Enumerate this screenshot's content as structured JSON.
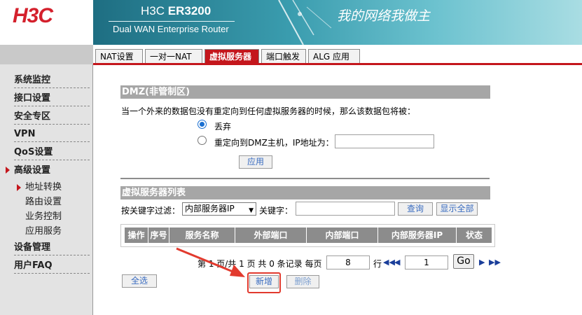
{
  "header": {
    "logo": "H3C",
    "product_prefix": "H3C",
    "product_model": "ER3200",
    "product_subtitle": "Dual WAN Enterprise Router",
    "slogan": "我的网络我做主"
  },
  "sidebar": {
    "items": [
      {
        "label": "系统监控"
      },
      {
        "label": "接口设置"
      },
      {
        "label": "安全专区"
      },
      {
        "label": "VPN"
      },
      {
        "label": "QoS设置"
      },
      {
        "label": "高级设置"
      },
      {
        "label": "设备管理"
      },
      {
        "label": "用户FAQ"
      }
    ],
    "subitems": [
      {
        "label": "地址转换"
      },
      {
        "label": "路由设置"
      },
      {
        "label": "业务控制"
      },
      {
        "label": "应用服务"
      }
    ]
  },
  "tabs": [
    {
      "label": "NAT设置"
    },
    {
      "label": "一对一NAT"
    },
    {
      "label": "虚拟服务器"
    },
    {
      "label": "端口触发"
    },
    {
      "label": "ALG 应用"
    }
  ],
  "dmz": {
    "title": "DMZ(非管制区)",
    "description": "当一个外来的数据包没有重定向到任何虚拟服务器的时候，那么该数据包将被：",
    "option_discard": "丢弃",
    "option_redirect": "重定向到DMZ主机，IP地址为：",
    "ip_value": "",
    "apply_label": "应用"
  },
  "vs_list": {
    "title": "虚拟服务器列表",
    "filter_label": "按关键字过滤：",
    "filter_select": "内部服务器IP",
    "keyword_label": "关键字：",
    "keyword_value": "",
    "query_label": "查询",
    "show_all_label": "显示全部",
    "columns": [
      "操作",
      "序号",
      "服务名称",
      "外部端口",
      "内部端口",
      "内部服务器IP",
      "状态"
    ]
  },
  "pager": {
    "text_prefix": "第 1 页/共 1 页 共 0 条记录 每页",
    "per_page": "8",
    "rows_label": "行",
    "page_value": "1",
    "go_label": "Go"
  },
  "actions": {
    "select_all": "全选",
    "add": "新增",
    "delete": "删除"
  },
  "colors": {
    "accent": "#c4161c",
    "header_gray": "#a6a6a6",
    "highlight": "#e23a2e"
  }
}
